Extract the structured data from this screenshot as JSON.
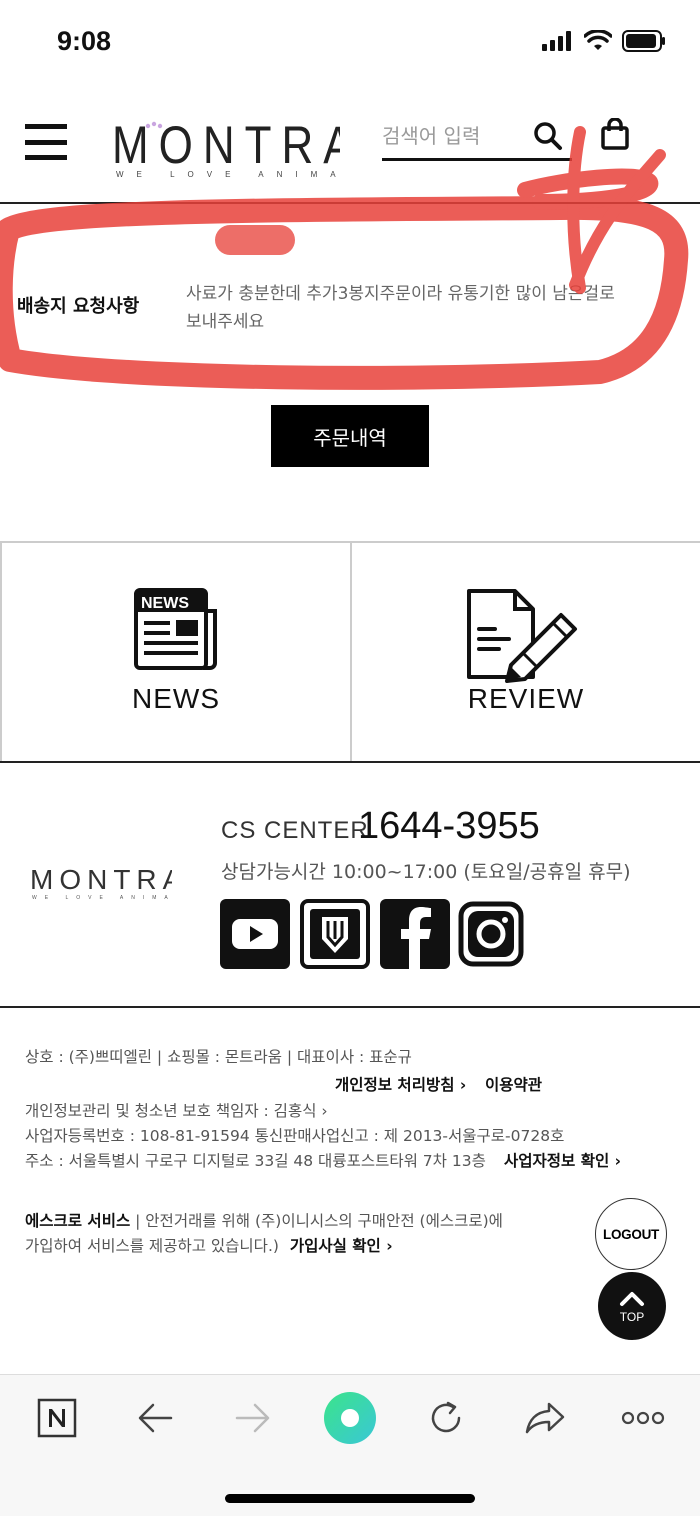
{
  "status_bar": {
    "time": "9:08"
  },
  "header": {
    "logo_text": "MONTRAUM",
    "logo_tagline": "WE LOVE ANIMALS",
    "search_placeholder": "검색어 입력"
  },
  "request": {
    "label": "배송지 요청사항",
    "text": "사료가 충분한데 추가3봉지주문이라 유통기한 많이 남은걸로 보내주세요"
  },
  "order_button": "주문내역",
  "tiles": [
    {
      "label": "NEWS",
      "icon": "newspaper-icon"
    },
    {
      "label": "REVIEW",
      "icon": "document-pencil-icon"
    }
  ],
  "cs_center": {
    "title": "CS CENTER",
    "phone": "1644-3955",
    "hours": "상담가능시간 10:00~17:00 (토요일/공휴일 휴무)",
    "social": [
      "youtube-icon",
      "blog-icon",
      "facebook-icon",
      "instagram-icon"
    ]
  },
  "footer": {
    "line1": "상호 : (주)쁘띠엘린 | 쇼핑몰 : 몬트라움 | 대표이사 : 표순규",
    "privacy_link": "개인정보 처리방침 ›",
    "terms_link": "이용약관",
    "line3": "개인정보관리 및 청소년 보호 책임자 : 김홍식 ›",
    "line4": "사업자등록번호 : 108-81-91594 통신판매사업신고 : 제 2013-서울구로-0728호",
    "line5": "주소 : 서울특별시 구로구 디지털로 33길 48 대륭포스트타워 7차 13층",
    "biz_info_link": "사업자정보 확인 ›",
    "escrow_bold": "에스크로 서비스",
    "escrow_text": " | 안전거래를 위해 (주)이니시스의 구매안전 (에스크로)에",
    "escrow_text2": "가입하여 서비스를 제공하고 있습니다.)",
    "escrow_link": "가입사실 확인 ›"
  },
  "logout_button": "LOGOUT",
  "top_button": "TOP",
  "browser_bar": {
    "items": [
      "naver-icon",
      "back-arrow-icon",
      "forward-arrow-icon",
      "green-dot-icon",
      "reload-icon",
      "share-icon",
      "more-icon"
    ],
    "accent": "#3ed6b4"
  },
  "colors": {
    "scribble": "#e8413a",
    "text": "#111111"
  }
}
